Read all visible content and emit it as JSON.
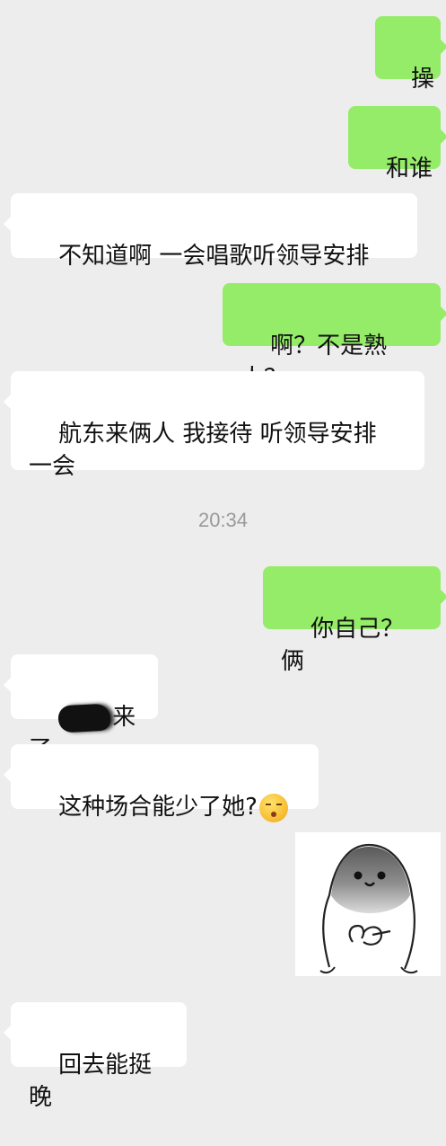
{
  "messages": [
    {
      "from": "me",
      "text": "操"
    },
    {
      "from": "me",
      "text": "和谁"
    },
    {
      "from": "other",
      "text": "不知道啊 一会唱歌听领导安排"
    },
    {
      "from": "me",
      "text": "啊？不是熟人？"
    },
    {
      "from": "other",
      "text": "航东来俩人 我接待 听领导安排\n一会"
    },
    {
      "time": "20:34"
    },
    {
      "from": "me",
      "text": "你自己？俩"
    },
    {
      "from": "other",
      "text": "来了",
      "redacted_prefix": true
    },
    {
      "from": "other",
      "text": "这种场合能少了她?",
      "emoji": "hushed-face-emoji"
    },
    {
      "from": "me",
      "type": "sticker",
      "sticker": "blob-character-sticker"
    },
    {
      "from": "other",
      "text": "回去能挺晚"
    }
  ],
  "colors": {
    "background": "#ededed",
    "bubble_mine": "#95ec69",
    "bubble_other": "#ffffff",
    "timestamp": "#9a9a9a"
  }
}
